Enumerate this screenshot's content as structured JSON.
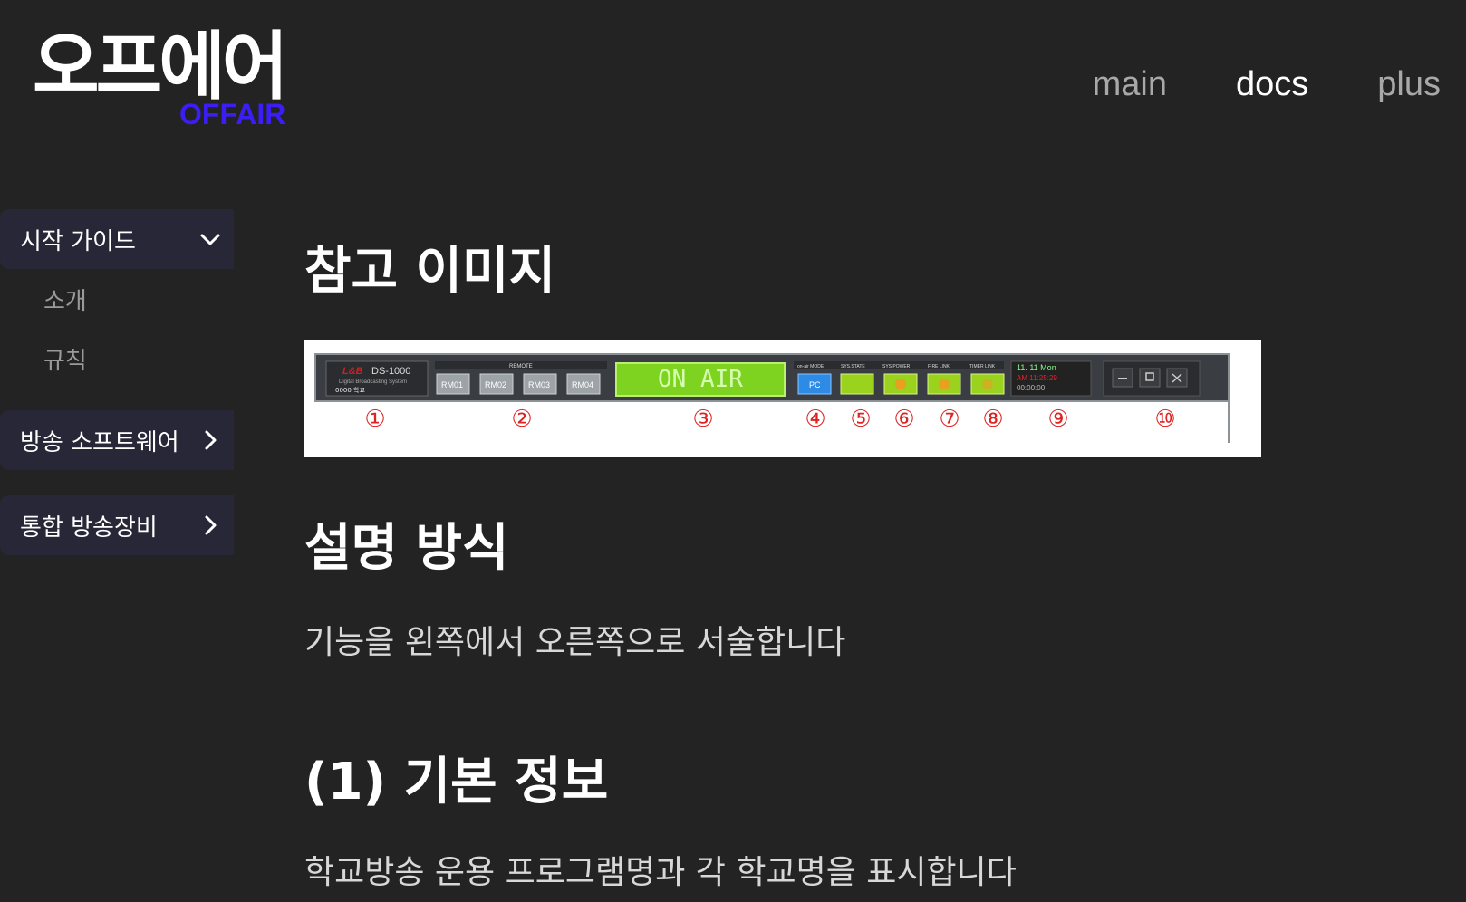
{
  "logo": {
    "ko": "오프에어",
    "en": "OFFAIR"
  },
  "topnav": [
    {
      "label": "main"
    },
    {
      "label": "docs",
      "active": true
    },
    {
      "label": "plus"
    }
  ],
  "sidebar": {
    "groups": [
      {
        "label": "시작 가이드",
        "expanded": true,
        "children": [
          "소개",
          "규칙"
        ]
      },
      {
        "label": "방송 소프트웨어",
        "expanded": false
      },
      {
        "label": "통합 방송장비",
        "expanded": false
      }
    ]
  },
  "content": {
    "h_ref": "참고 이미지",
    "h_method": "설명 방식",
    "p_method": "기능을 왼쪽에서 오른쪽으로 서술합니다",
    "h_basic": "(1) 기본 정보",
    "p_basic": "학교방송 운용 프로그램명과 각 학교명을 표시합니다"
  },
  "panel_image": {
    "brand": "L&B",
    "model": "DS-1000",
    "subtitle": "Digital Broadcasting System",
    "school": "0000 학교",
    "remote_title": "REMOTE",
    "remote_buttons": [
      "RM01",
      "RM02",
      "RM03",
      "RM04"
    ],
    "onair": "ON AIR",
    "mode_labels": [
      "on-air MODE",
      "SYS.STATE",
      "SYS.POWER",
      "FIRE LINK",
      "TIMER LINK"
    ],
    "mode_pc": "PC",
    "date": "11. 11  Mon",
    "time": "AM 11:25:29",
    "timer": "00:00:00",
    "numbers": [
      "①",
      "②",
      "③",
      "④",
      "⑤",
      "⑥",
      "⑦",
      "⑧",
      "⑨",
      "⑩"
    ]
  },
  "colors": {
    "background": "#232323",
    "logo_en": "#3a1ef5",
    "sidebar_group_bg": "#272737",
    "nav_inactive": "#a8a8a8",
    "onair_green": "#7ed321",
    "marker_red": "#dd2222"
  }
}
